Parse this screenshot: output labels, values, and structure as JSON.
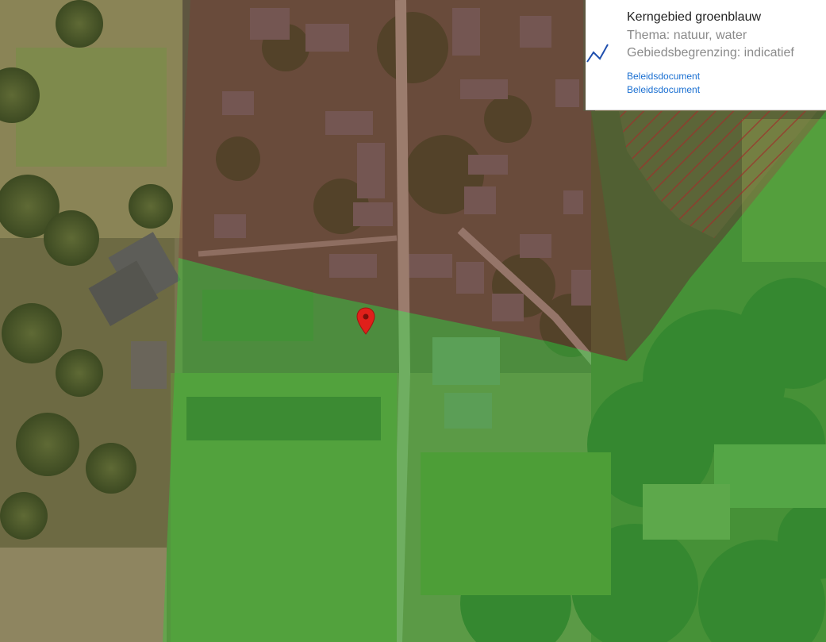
{
  "legend": {
    "title": "Kerngebied groenblauw",
    "theme": "Thema: natuur, water",
    "boundary": "Gebiedsbegrenzing: indicatief",
    "links": [
      "Beleidsdocument",
      "Beleidsdocument"
    ],
    "line_color": "#1f4fae"
  },
  "map": {
    "marker_icon": "map-pin-icon",
    "marker_color": "#e0201a",
    "green_area_color": "#3cc23c",
    "red_area_color": "#8a2d2d",
    "hatch_color": "#a0322d"
  }
}
